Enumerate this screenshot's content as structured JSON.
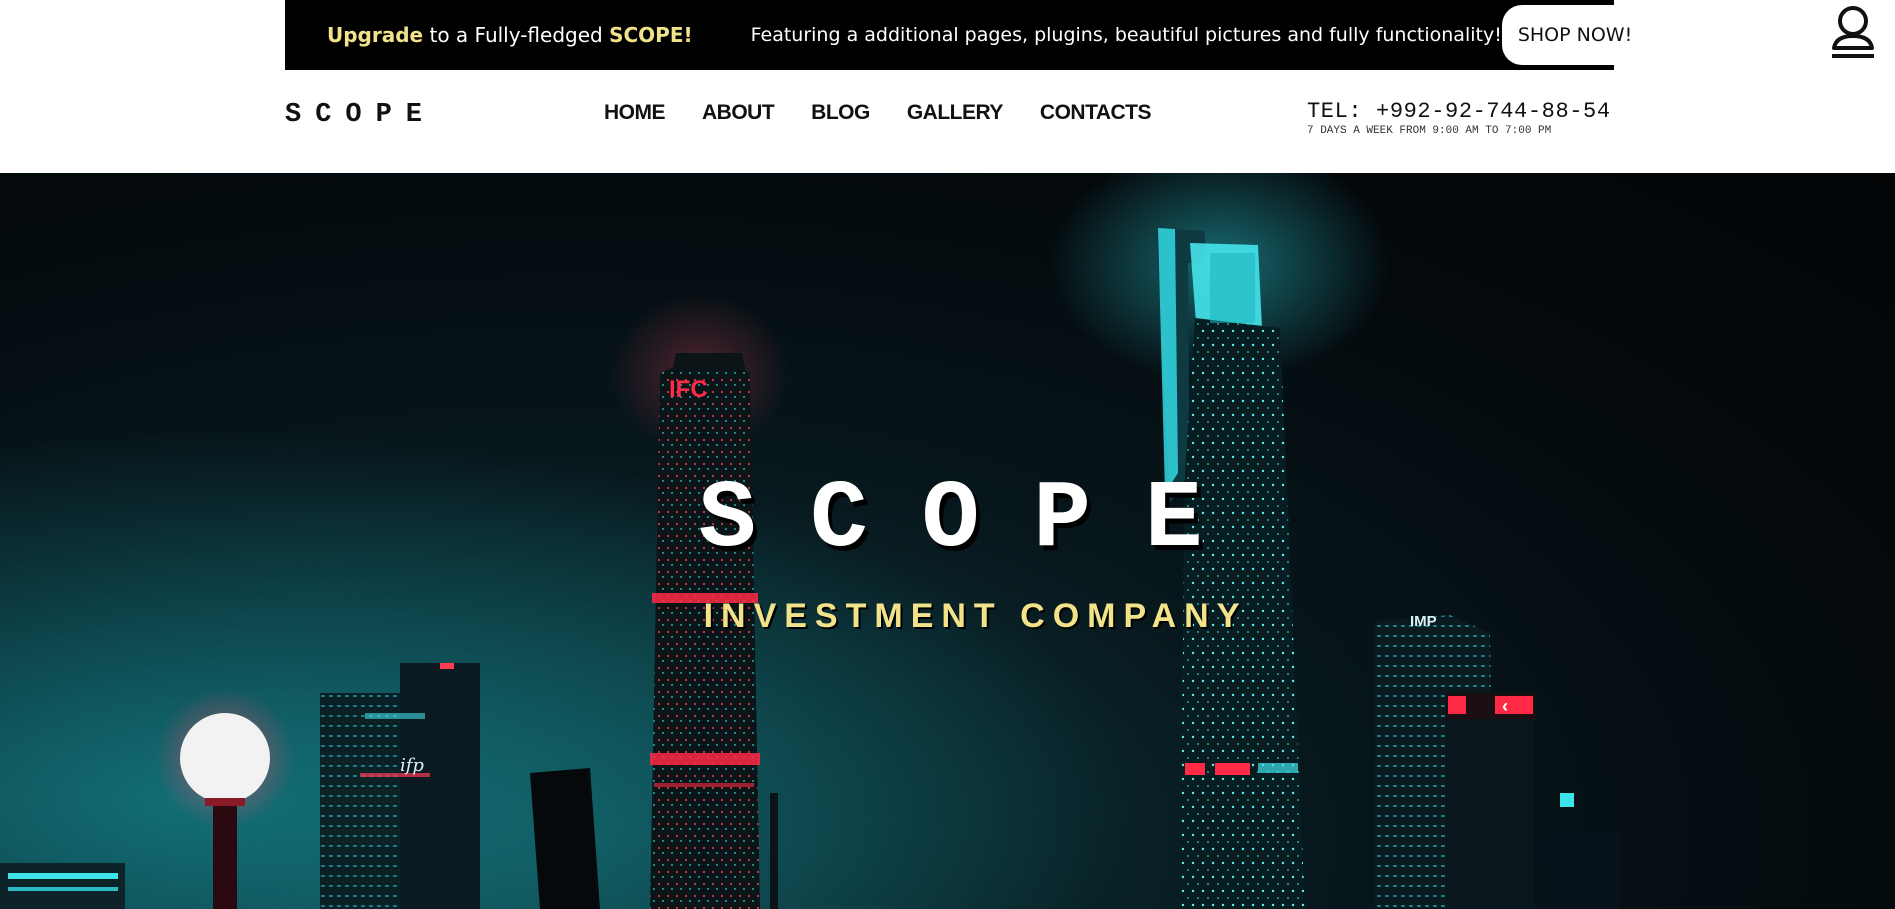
{
  "promo": {
    "upgrade_word": "Upgrade",
    "middle_text": " to a Fully-fledged ",
    "brand_word": "SCOPE!",
    "features_text": "Featuring a additional pages, plugins, beautiful pictures and fully functionality!",
    "shop_button": "SHOP NOW!"
  },
  "header": {
    "logo": "SCOPE",
    "nav": [
      {
        "label": "HOME"
      },
      {
        "label": "ABOUT"
      },
      {
        "label": "BLOG"
      },
      {
        "label": "GALLERY"
      },
      {
        "label": "CONTACTS"
      }
    ],
    "tel": "TEL: +992-92-744-88-54",
    "hours": "7 DAYS A WEEK FROM 9:00 AM TO 7:00 PM"
  },
  "user_menu": {
    "icon": "user-icon"
  },
  "hero": {
    "title": "SCOPE",
    "subtitle": "INVESTMENT COMPANY",
    "sign_ifc": "IFC",
    "sign_ifp": "ifp",
    "sign_imp": "IMP"
  },
  "colors": {
    "accent_yellow": "#f2e38a",
    "promo_bg": "#000000",
    "hero_teal": "#19c9d6",
    "hero_red": "#e0203a"
  }
}
